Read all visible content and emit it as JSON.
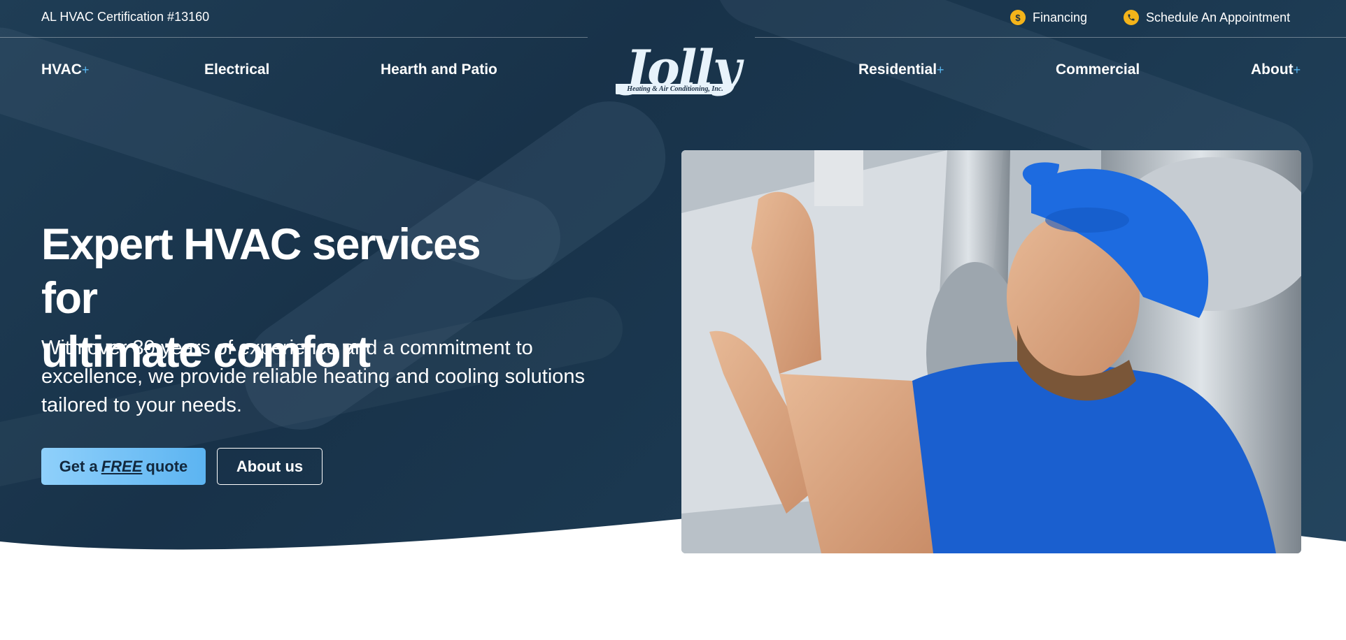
{
  "topbar": {
    "certification": "AL HVAC Certification #13160",
    "financing_label": "Financing",
    "schedule_label": "Schedule An Appointment"
  },
  "nav": {
    "left": [
      {
        "label": "HVAC",
        "has_submenu": true
      },
      {
        "label": "Electrical",
        "has_submenu": false
      },
      {
        "label": "Hearth and Patio",
        "has_submenu": false
      }
    ],
    "right": [
      {
        "label": "Residential",
        "has_submenu": true
      },
      {
        "label": "Commercial",
        "has_submenu": false
      },
      {
        "label": "About",
        "has_submenu": true
      }
    ],
    "plus_symbol": "+"
  },
  "logo": {
    "wordmark": "Jolly",
    "tagline": "Heating & Air Conditioning, Inc."
  },
  "hero": {
    "headline_line1": "Expert HVAC services for",
    "headline_line2": "ultimate comfort",
    "subcopy": "With over 30 years of experience and a commitment to excellence, we provide reliable heating and cooling solutions tailored to your needs.",
    "cta_quote_prefix": "Get a",
    "cta_quote_emphasis": "FREE",
    "cta_quote_suffix": "quote",
    "cta_about": "About us"
  },
  "icons": {
    "financing": "dollar-coin-icon",
    "schedule": "phone-icon"
  },
  "colors": {
    "hero_bg": "#1b3850",
    "accent_blue": "#5cb4f1",
    "icon_yellow": "#f4b41a",
    "text_on_dark": "#ffffff"
  }
}
